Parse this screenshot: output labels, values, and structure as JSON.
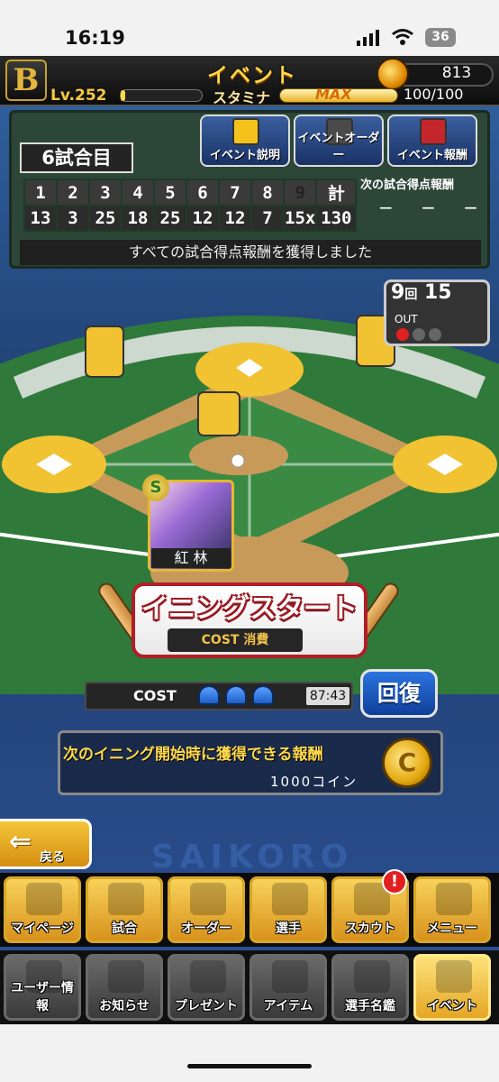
{
  "status": {
    "time": "16:19",
    "battery": "36"
  },
  "header": {
    "title": "イベント",
    "coins": "813",
    "level_prefix": "Lv.",
    "level": "252",
    "stamina_label": "スタミナ",
    "stamina_max": "MAX",
    "stamina_value": "100/100"
  },
  "scoreboard": {
    "game_label": "6試合目",
    "innings": [
      "1",
      "2",
      "3",
      "4",
      "5",
      "6",
      "7",
      "8",
      "9",
      "計"
    ],
    "scores": [
      "13",
      "3",
      "25",
      "18",
      "25",
      "12",
      "12",
      "7",
      "15x",
      "130"
    ],
    "reward_title": "次の試合得点報酬",
    "reward_dashes": "− − −",
    "message": "すべての試合得点報酬を獲得しました"
  },
  "event_buttons": [
    {
      "label": "イベント説明"
    },
    {
      "label": "イベントオーダー"
    },
    {
      "label": "イベント報酬"
    }
  ],
  "field": {
    "inning_num": "9",
    "inning_unit": "回",
    "score": "15",
    "out_label": "OUT",
    "card_name": "紅 林",
    "card_rank": "S"
  },
  "start": {
    "label": "イニングスタート",
    "cost_label": "COST 消費"
  },
  "cost": {
    "label": "COST",
    "timer": "87:43",
    "recover_label": "回復"
  },
  "reward": {
    "line1": "次のイニング開始時に獲得できる報酬",
    "line2": "1000コイン",
    "coin_symbol": "C"
  },
  "back": {
    "label": "戻る",
    "arrow": "⇐"
  },
  "watermark": "SAIKORO",
  "nav_primary": [
    {
      "label": "マイページ"
    },
    {
      "label": "試合"
    },
    {
      "label": "オーダー"
    },
    {
      "label": "選手"
    },
    {
      "label": "スカウト"
    },
    {
      "label": "メニュー"
    }
  ],
  "nav_secondary": [
    {
      "label": "ユーザー情報"
    },
    {
      "label": "お知らせ"
    },
    {
      "label": "プレゼント"
    },
    {
      "label": "アイテム"
    },
    {
      "label": "選手名鑑"
    },
    {
      "label": "イベント"
    }
  ],
  "alert_badge": "!",
  "colors": {
    "accent": "#f3c21b",
    "button_red": "#b01e28",
    "recover_blue": "#2c74e0",
    "field_green": "#2f7a3a"
  }
}
